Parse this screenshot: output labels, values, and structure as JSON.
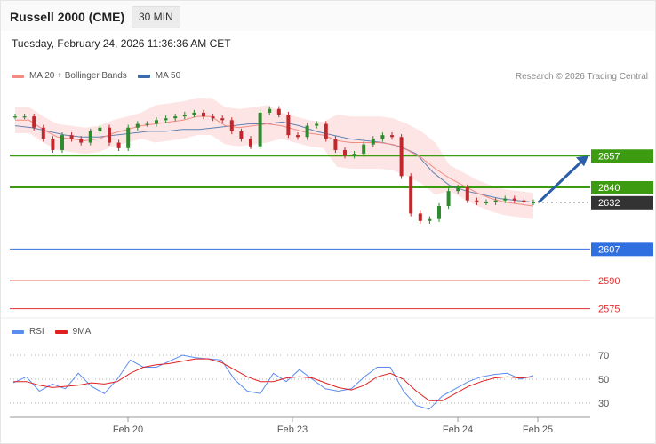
{
  "header": {
    "title": "Russell 2000 (CME)",
    "timeframe": "30 MIN",
    "timestamp": "Tuesday, February 24, 2026 11:36:36 AM CET",
    "copyright": "Research © 2026 Trading Central"
  },
  "legend": {
    "price": [
      {
        "label": "MA 20 + Bollinger Bands",
        "color": "#f28b82"
      },
      {
        "label": "MA 50",
        "color": "#3d6aa8"
      }
    ],
    "rsi": [
      {
        "label": "RSI",
        "color": "#5b8def"
      },
      {
        "label": "9MA",
        "color": "#e02020"
      }
    ]
  },
  "chart_data": [
    {
      "type": "line",
      "title": "Russell 2000 (CME)",
      "timeframe": "30 MIN",
      "x_ticks": [
        "Feb 20",
        "Feb 23",
        "Feb 24",
        "Feb 25"
      ],
      "ylim": [
        2571,
        2689
      ],
      "grid": false,
      "series": [
        {
          "name": "Price",
          "style": "candlestick",
          "color_up": "#2e8b2e",
          "color_down": "#c0282d",
          "values": [
            2678,
            2678,
            2672,
            2666,
            2660,
            2668,
            2666,
            2664,
            2670,
            2672,
            2664,
            2661,
            2672,
            2674,
            2674,
            2676,
            2677,
            2678,
            2679,
            2680,
            2678,
            2677,
            2676,
            2670,
            2666,
            2662,
            2680,
            2682,
            2679,
            2668,
            2667,
            2673,
            2674,
            2666,
            2660,
            2657,
            2658,
            2663,
            2666,
            2668,
            2667,
            2646,
            2626,
            2622,
            2623,
            2630,
            2638,
            2640,
            2633,
            2632,
            2632,
            2633,
            2634,
            2633,
            2632,
            2632
          ]
        },
        {
          "name": "MA 20",
          "color": "#f28b82",
          "values": [
            2676,
            2676,
            2671,
            2667,
            2666,
            2665,
            2666,
            2669,
            2671,
            2673,
            2674,
            2675,
            2676,
            2678,
            2678,
            2673,
            2672,
            2673,
            2674,
            2673,
            2671,
            2669,
            2668,
            2665,
            2664,
            2664,
            2664,
            2663,
            2660,
            2656,
            2650,
            2645,
            2641,
            2637,
            2634,
            2632,
            2631,
            2630
          ]
        },
        {
          "name": "MA 50",
          "color": "#3d6aa8",
          "values": [
            2673,
            2672,
            2670,
            2668,
            2667,
            2667,
            2668,
            2669,
            2670,
            2670,
            2671,
            2671,
            2672,
            2673,
            2674,
            2674,
            2675,
            2673,
            2670,
            2668,
            2666,
            2665,
            2664,
            2662,
            2658,
            2648,
            2641,
            2638,
            2636,
            2634,
            2633,
            2632
          ]
        }
      ],
      "levels": [
        {
          "value": 2657,
          "label": "2657",
          "type": "resistance",
          "color": "#3d9b12"
        },
        {
          "value": 2640,
          "label": "2640",
          "type": "pivot",
          "color": "#3d9b12"
        },
        {
          "value": 2632,
          "label": "2632",
          "type": "last",
          "color": "#333333"
        },
        {
          "value": 2607,
          "label": "2607",
          "type": "support",
          "color": "#2f6fe0"
        },
        {
          "value": 2590,
          "label": "2590",
          "type": "support",
          "color": "#e03030"
        },
        {
          "value": 2575,
          "label": "2575",
          "type": "support",
          "color": "#e03030"
        }
      ],
      "forecast": {
        "from": 2632,
        "to": 2657,
        "color": "#2a5ea8"
      }
    },
    {
      "type": "line",
      "title": "RSI",
      "x_ticks": [
        "Feb 20",
        "Feb 23",
        "Feb 24",
        "Feb 25"
      ],
      "ylim": [
        20,
        80
      ],
      "y_ticks": [
        "70",
        "50",
        "30"
      ],
      "series": [
        {
          "name": "RSI",
          "color": "#5b8def",
          "values": [
            47,
            52,
            40,
            46,
            42,
            55,
            44,
            38,
            50,
            66,
            60,
            60,
            65,
            70,
            68,
            67,
            66,
            50,
            40,
            38,
            55,
            48,
            58,
            50,
            42,
            40,
            42,
            52,
            60,
            60,
            40,
            28,
            25,
            36,
            42,
            48,
            52,
            54,
            55,
            50,
            53
          ]
        },
        {
          "name": "9MA",
          "color": "#e02020",
          "values": [
            48,
            48,
            45,
            43,
            44,
            45,
            47,
            46,
            48,
            55,
            60,
            62,
            63,
            65,
            67,
            67,
            64,
            58,
            52,
            48,
            48,
            51,
            52,
            51,
            47,
            43,
            41,
            45,
            52,
            55,
            50,
            40,
            32,
            32,
            38,
            44,
            48,
            51,
            52,
            51,
            52
          ]
        }
      ]
    }
  ]
}
